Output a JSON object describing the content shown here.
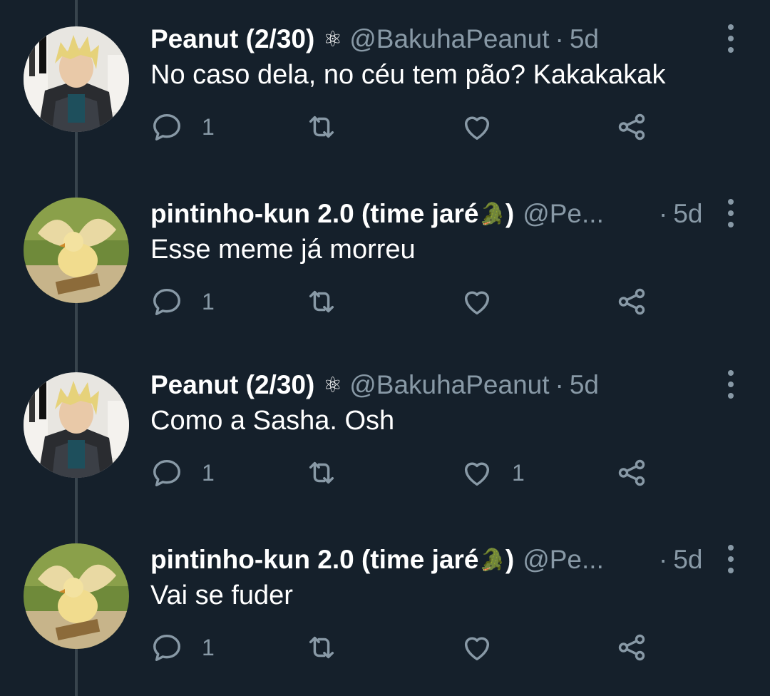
{
  "colors": {
    "background": "#15202b",
    "text": "#ffffff",
    "secondary": "#8899a6",
    "thread_line": "#38444d"
  },
  "tweets": [
    {
      "avatar": "anime-character-avatar",
      "name": "Peanut (2/30)",
      "badge": "⚛",
      "badge_icon": "atom-icon",
      "handle": "@BakuhaPeanut",
      "separator": "·",
      "time": "5d",
      "text": "No caso dela, no céu tem pão? Kakakakak",
      "reply_count": "1",
      "retweet_count": "",
      "like_count": ""
    },
    {
      "avatar": "chick-photo-avatar",
      "name": "pintinho-kun 2.0 (time jaré",
      "badge": "🐊",
      "badge_icon": "crocodile-emoji",
      "name_suffix": ")",
      "handle": "@Pe...",
      "separator": "·",
      "time": "5d",
      "text": "Esse meme já morreu",
      "reply_count": "1",
      "retweet_count": "",
      "like_count": ""
    },
    {
      "avatar": "anime-character-avatar",
      "name": "Peanut (2/30)",
      "badge": "⚛",
      "badge_icon": "atom-icon",
      "handle": "@BakuhaPeanut",
      "separator": "·",
      "time": "5d",
      "text": "Como a Sasha. Osh",
      "reply_count": "1",
      "retweet_count": "",
      "like_count": "1"
    },
    {
      "avatar": "chick-photo-avatar",
      "name": "pintinho-kun 2.0 (time jaré",
      "badge": "🐊",
      "badge_icon": "crocodile-emoji",
      "name_suffix": ")",
      "handle": "@Pe...",
      "separator": "·",
      "time": "5d",
      "text": "Vai se fuder",
      "reply_count": "1",
      "retweet_count": "",
      "like_count": ""
    }
  ]
}
